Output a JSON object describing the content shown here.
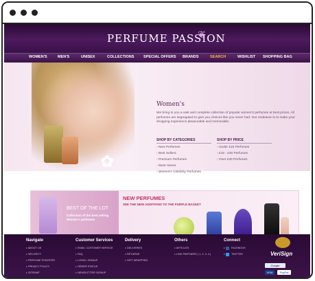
{
  "site": {
    "logo": "PERFUME PASSION",
    "nav": [
      "WOMEN'S",
      "MEN'S",
      "UNISEX",
      "COLLECTIONS",
      "SPECIAL OFFERS",
      "BRANDS",
      "SEARCH",
      "WISHLIST",
      "SHOPPING BAG"
    ],
    "hero": {
      "title": "Women's",
      "desc": "We bring to you a vast and complete collection of popular women's perfumes at best prices. All perfumes are segregated to give you choices like you never had. Our endeavor is to make your shopping experience pleasurable and memorable.",
      "categories_heading": "SHOP BY CATEGORIES",
      "categories": [
        "New Perfumes",
        "Best Sellers",
        "Premium Perfumes",
        "Must Haves",
        "Women's Celebrity Perfumes"
      ],
      "price_heading": "SHOP BY PRICE",
      "prices": [
        "Under £15 Perfumes",
        "£15 - £30 Perfumes",
        "Over £30 Perfumes"
      ]
    },
    "promo": {
      "best_title": "BEST OF THE LOT",
      "best_sub": "Collection of the best selling Women's perfumes",
      "new_title": "NEW PERFUMES",
      "new_sub": "SEE THE NEW ADDITIONS TO THE PURPLE BASKET"
    },
    "footer": {
      "navigate": {
        "heading": "Navigate",
        "links": [
          "ABOUT US",
          "SECURITY",
          "PERFUME POINTERS",
          "PRIVACY POLICY",
          "SITEMAP"
        ]
      },
      "customer": {
        "heading": "Customer Services",
        "links": [
          "EMAIL CUSTOMER SERVICE",
          "FAQ",
          "LOGIN / SIGNUP",
          "ORDER STATUS",
          "NEWSLETTER SIGNUP"
        ]
      },
      "delivery": {
        "heading": "Delivery",
        "links": [
          "DELIVERIES",
          "RETURNS",
          "GIFT WRAPPING"
        ]
      },
      "others": {
        "heading": "Others",
        "links": [
          "ARTICLES",
          "LINK PARTNERS ( 1, 2, 3, 4 )"
        ]
      },
      "connect": {
        "heading": "Connect",
        "links": [
          "FACEBOOK",
          "TWITTER"
        ]
      },
      "verisign": "VeriSign",
      "badges": [
        "Google Checkout",
        "VISA",
        "PayPal"
      ]
    }
  },
  "colors": {
    "brand_purple": "#3c1349",
    "accent_orange": "#ffb347",
    "pink_title": "#c0306a"
  }
}
